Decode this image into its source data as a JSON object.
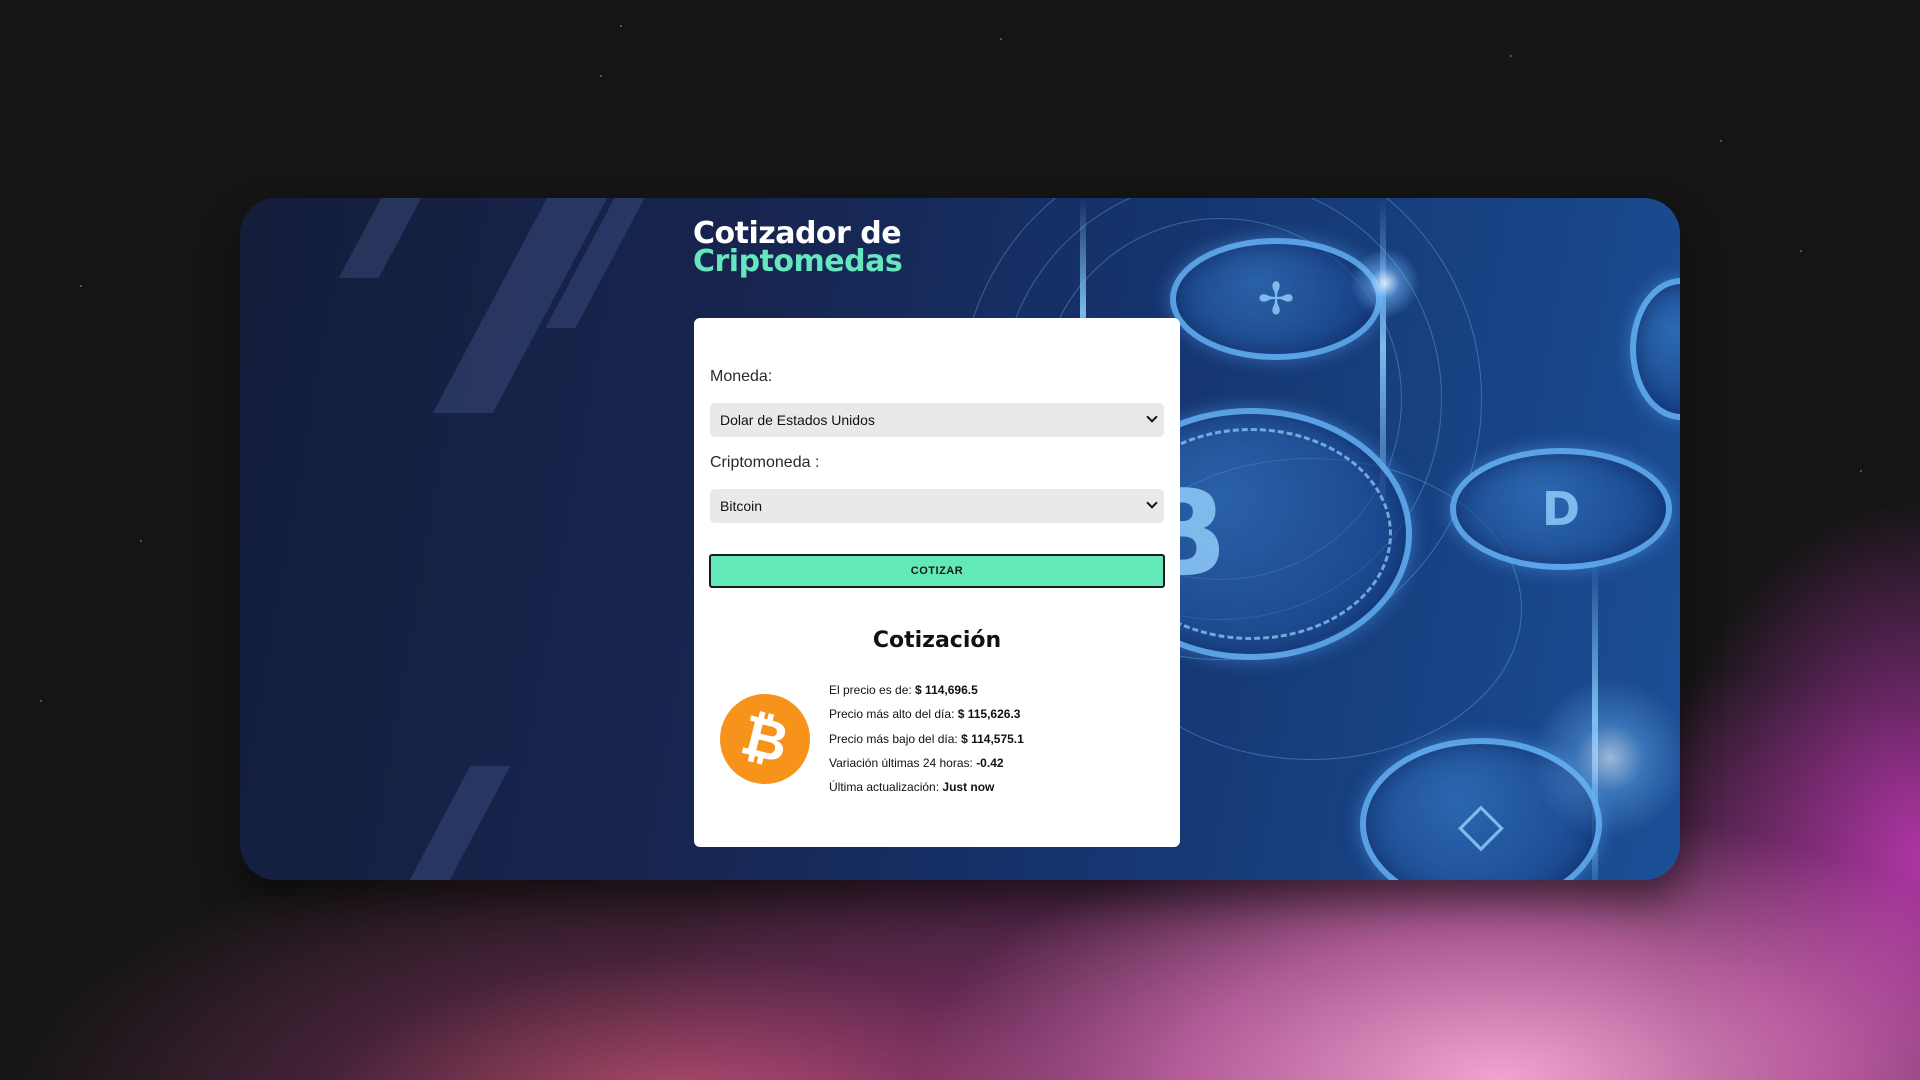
{
  "app": {
    "title_line1": "Cotizador de",
    "title_line2": "Criptomedas"
  },
  "form": {
    "currency_label": "Moneda:",
    "currency_selected": "Dolar de Estados Unidos",
    "crypto_label": "Criptomoneda :",
    "crypto_selected": "Bitcoin",
    "submit_label": "COTIZAR"
  },
  "result": {
    "heading": "Cotización",
    "coin_icon": "bitcoin-logo-icon",
    "rows": [
      {
        "label": "El precio es de: ",
        "value": "$ 114,696.5"
      },
      {
        "label": "Precio más alto del día: ",
        "value": "$ 115,626.3"
      },
      {
        "label": "Precio más bajo del día: ",
        "value": "$ 114,575.1"
      },
      {
        "label": "Variación últimas 24 horas: ",
        "value": "-0.42"
      },
      {
        "label": "Última actualización: ",
        "value": "Just now"
      }
    ]
  },
  "colors": {
    "accent": "#63e8b7",
    "bitcoin": "#f7931a",
    "card_bg": "#172550"
  }
}
